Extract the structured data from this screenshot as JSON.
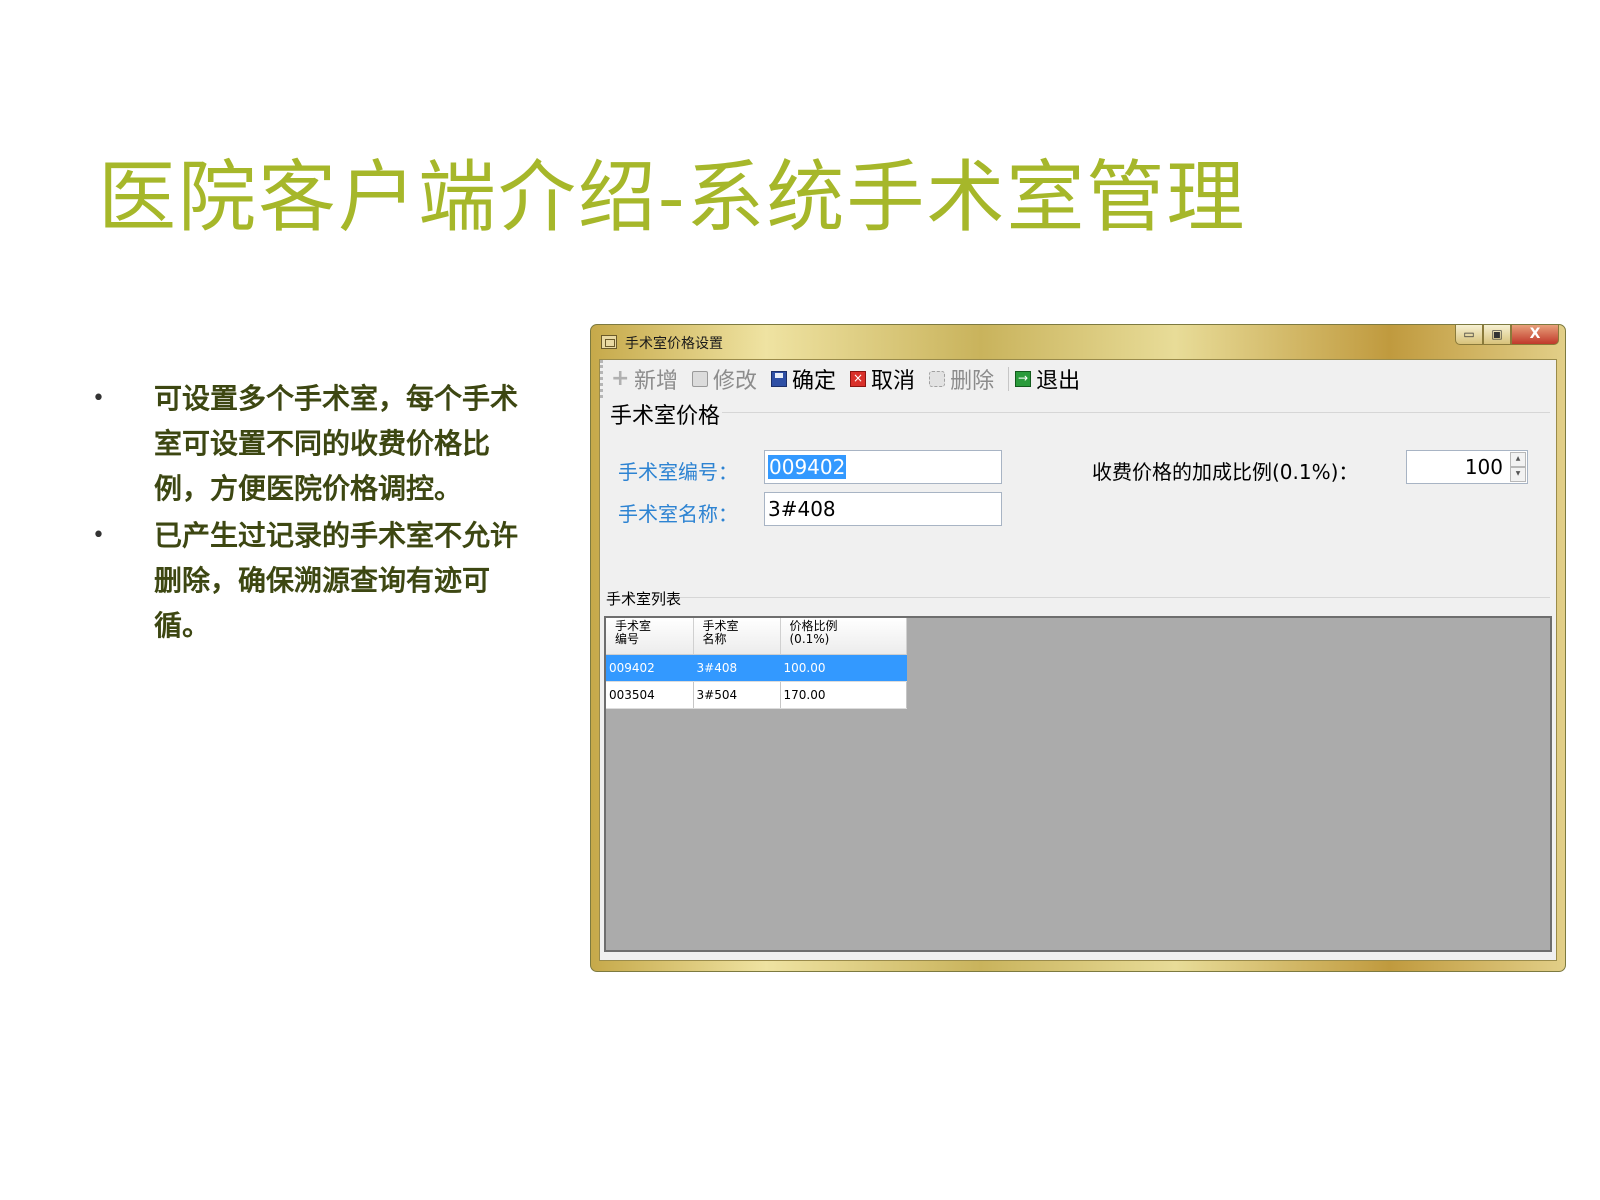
{
  "slide": {
    "title": "医院客户端介绍-系统手术室管理",
    "bullets": [
      {
        "marker": "•",
        "text": "可设置多个手术室，每个手术室可设置不同的收费价格比例，方便医院价格调控。"
      },
      {
        "marker": "•",
        "text": "已产生过记录的手术室不允许删除，确保溯源查询有迹可循。"
      }
    ]
  },
  "window": {
    "title": "手术室价格设置",
    "controls": {
      "minimize": "▭",
      "maximize": "▣",
      "close": "X"
    }
  },
  "toolbar": {
    "add": "新增",
    "edit": "修改",
    "confirm": "确定",
    "cancel": "取消",
    "delete": "删除",
    "exit": "退出"
  },
  "form": {
    "group_title": "手术室价格",
    "room_code_label": "手术室编号：",
    "room_code_value": "009402",
    "room_name_label": "手术室名称：",
    "room_name_value": "3#408",
    "ratio_label": "收费价格的加成比例(0.1%)：",
    "ratio_value": "100"
  },
  "list": {
    "title": "手术室列表",
    "columns": [
      {
        "line1": "手术室",
        "line2": "编号"
      },
      {
        "line1": "手术室",
        "line2": "名称"
      },
      {
        "line1": "价格比例",
        "line2": "(0.1%)"
      }
    ],
    "rows": [
      [
        "009402",
        "3#408",
        "100.00"
      ],
      [
        "003504",
        "3#504",
        "170.00"
      ]
    ],
    "selected_row": 0
  },
  "colors": {
    "title_green": "#a6b72a",
    "bullet_text": "#3d4712",
    "label_blue": "#2d83d2",
    "selection_blue": "#3399ff",
    "grid_background": "#ababab"
  }
}
